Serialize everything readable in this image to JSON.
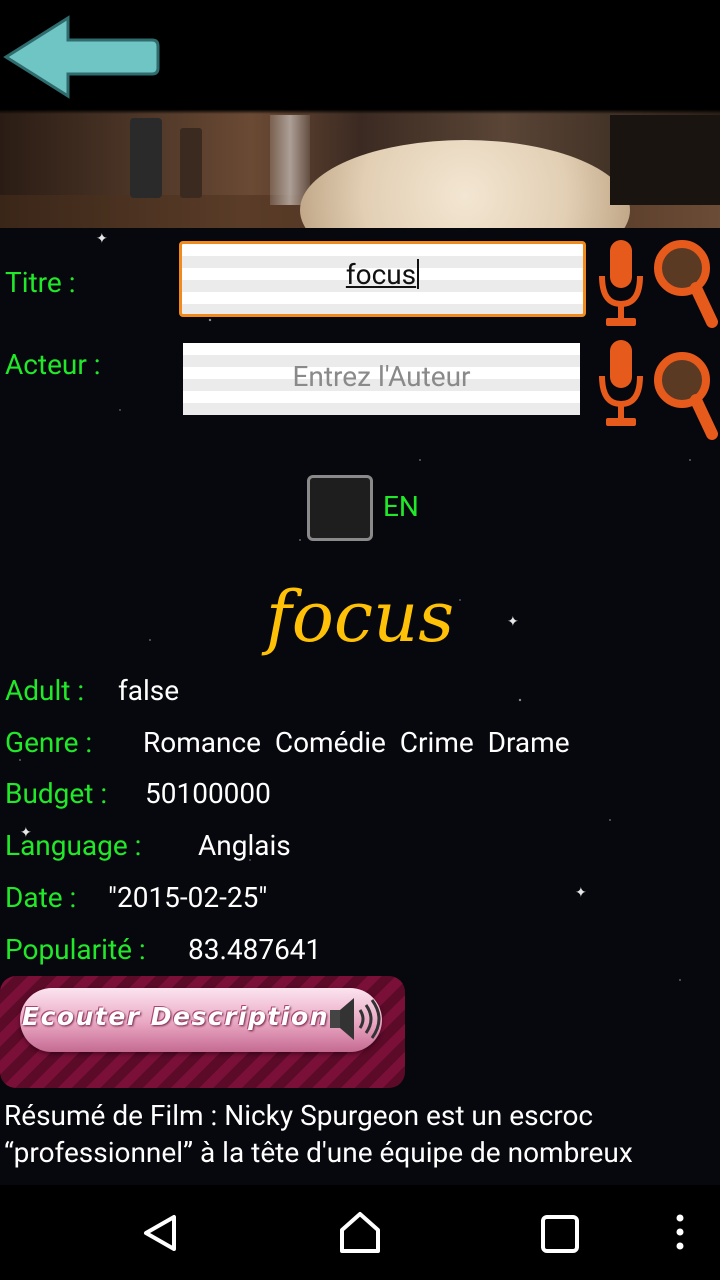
{
  "header": {
    "back_icon": "back-arrow-icon"
  },
  "search": {
    "title_label": "Titre :",
    "title_value": "focus",
    "actor_label": "Acteur :",
    "actor_placeholder": "Entrez l'Auteur",
    "mic_icon": "microphone-icon",
    "search_icon": "magnifier-icon"
  },
  "language_toggle": {
    "label": "EN",
    "checked": false
  },
  "movie": {
    "title": "focus",
    "details": [
      {
        "label": "Adult :",
        "value": "false"
      },
      {
        "label": "Genre :",
        "value": "Romance  Comédie  Crime  Drame"
      },
      {
        "label": "Budget :",
        "value": "50100000"
      },
      {
        "label": "Language :",
        "value": "Anglais"
      },
      {
        "label": "Date :",
        "value": "\"2015-02-25\""
      },
      {
        "label": "Popularité :",
        "value": "83.487641"
      }
    ],
    "listen_button": "Ecouter Description",
    "summary": "Résumé de Film :  Nicky Spurgeon est un escroc\n“professionnel” à la tête d'une équipe de nombreux"
  },
  "navbar": {
    "back": "nav-back-icon",
    "home": "nav-home-icon",
    "recents": "nav-recents-icon",
    "menu": "overflow-menu-icon"
  },
  "colors": {
    "label_green": "#22e82a",
    "title_gold": "#ffc107",
    "icon_orange": "#e65a1c",
    "focus_orange": "#f08a1c"
  }
}
